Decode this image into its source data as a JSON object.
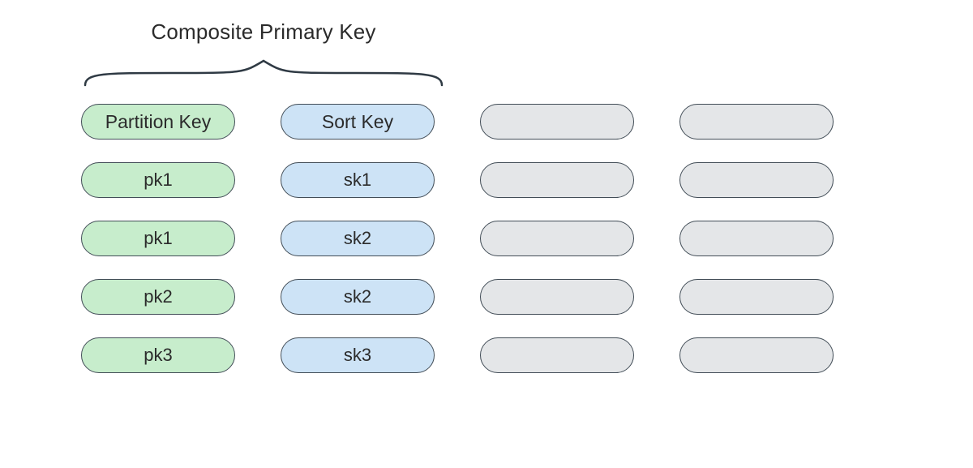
{
  "title": "Composite Primary Key",
  "columns": {
    "partition": {
      "header": "Partition Key"
    },
    "sort": {
      "header": "Sort Key"
    }
  },
  "rows": [
    {
      "pk": "pk1",
      "sk": "sk1"
    },
    {
      "pk": "pk1",
      "sk": "sk2"
    },
    {
      "pk": "pk2",
      "sk": "sk2"
    },
    {
      "pk": "pk3",
      "sk": "sk3"
    }
  ]
}
